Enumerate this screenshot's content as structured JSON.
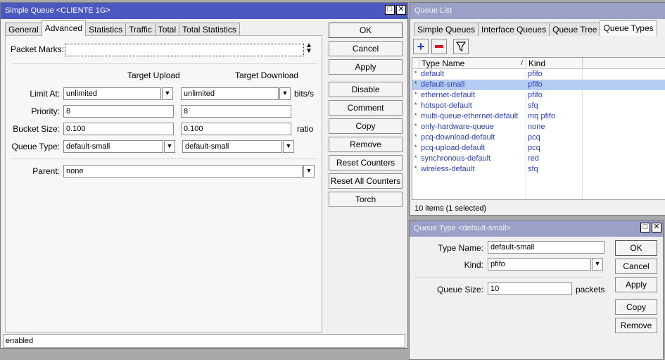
{
  "simple_queue": {
    "title": "Simple Queue <CLIENTE 1G>",
    "tabs": [
      "General",
      "Advanced",
      "Statistics",
      "Traffic",
      "Total",
      "Total Statistics"
    ],
    "packet_marks_label": "Packet Marks:",
    "packet_marks_value": "",
    "target_upload_header": "Target Upload",
    "target_download_header": "Target Download",
    "limit_at_label": "Limit At:",
    "limit_at_upload": "unlimited",
    "limit_at_download": "unlimited",
    "limit_unit": "bits/s",
    "priority_label": "Priority:",
    "priority_upload": "8",
    "priority_download": "8",
    "bucket_size_label": "Bucket Size:",
    "bucket_upload": "0.100",
    "bucket_download": "0.100",
    "bucket_unit": "ratio",
    "queue_type_label": "Queue Type:",
    "queue_type_upload": "default-small",
    "queue_type_download": "default-small",
    "parent_label": "Parent:",
    "parent_value": "none",
    "buttons": [
      "OK",
      "Cancel",
      "Apply",
      "Disable",
      "Comment",
      "Copy",
      "Remove",
      "Reset Counters",
      "Reset All Counters",
      "Torch"
    ],
    "status": "enabled"
  },
  "queue_list": {
    "title": "Queue List",
    "tabs": [
      "Simple Queues",
      "Interface Queues",
      "Queue Tree",
      "Queue Types"
    ],
    "toolbar_icons": [
      "add-icon",
      "remove-icon",
      "filter-icon"
    ],
    "columns": [
      "Type Name",
      "Kind"
    ],
    "sort_indicator": "/",
    "row_marker": "*",
    "rows": [
      {
        "name": "default",
        "kind": "pfifo"
      },
      {
        "name": "default-small",
        "kind": "pfifo"
      },
      {
        "name": "ethernet-default",
        "kind": "pfifo"
      },
      {
        "name": "hotspot-default",
        "kind": "sfq"
      },
      {
        "name": "multi-queue-ethernet-default",
        "kind": "mq pfifo"
      },
      {
        "name": "only-hardware-queue",
        "kind": "none"
      },
      {
        "name": "pcq-download-default",
        "kind": "pcq"
      },
      {
        "name": "pcq-upload-default",
        "kind": "pcq"
      },
      {
        "name": "synchronous-default",
        "kind": "red"
      },
      {
        "name": "wireless-default",
        "kind": "sfq"
      }
    ],
    "selected_row": 1,
    "status": "10 items (1 selected)"
  },
  "queue_type": {
    "title": "Queue Type <default-small>",
    "type_name_label": "Type Name:",
    "type_name_value": "default-small",
    "kind_label": "Kind:",
    "kind_value": "pfifo",
    "queue_size_label": "Queue Size:",
    "queue_size_value": "10",
    "queue_size_unit": "packets",
    "buttons": [
      "OK",
      "Cancel",
      "Apply",
      "Copy",
      "Remove"
    ]
  }
}
